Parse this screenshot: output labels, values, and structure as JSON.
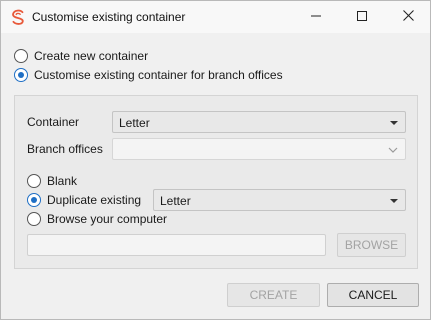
{
  "window": {
    "title": "Customise existing container",
    "brand_color": "#e8593a"
  },
  "mode": {
    "option_new": "Create new container",
    "option_existing": "Customise existing container for branch offices",
    "selected": "existing"
  },
  "form": {
    "container_label": "Container",
    "container_value": "Letter",
    "branch_offices_label": "Branch offices",
    "branch_offices_value": "",
    "source": {
      "blank": "Blank",
      "duplicate": "Duplicate existing",
      "duplicate_value": "Letter",
      "browse": "Browse your computer",
      "selected": "duplicate"
    },
    "path_value": "",
    "browse_button": "BROWSE"
  },
  "footer": {
    "create_button": "CREATE",
    "cancel_button": "CANCEL"
  },
  "colors": {
    "accent": "#1f6fc5",
    "disabled_text": "#a3a3a3"
  },
  "icons": {
    "app": "app-logo-icon",
    "minimize": "minimize-icon",
    "maximize": "maximize-icon",
    "close": "close-icon",
    "dropdown": "dropdown-arrow-icon",
    "chevron": "chevron-down-icon"
  }
}
